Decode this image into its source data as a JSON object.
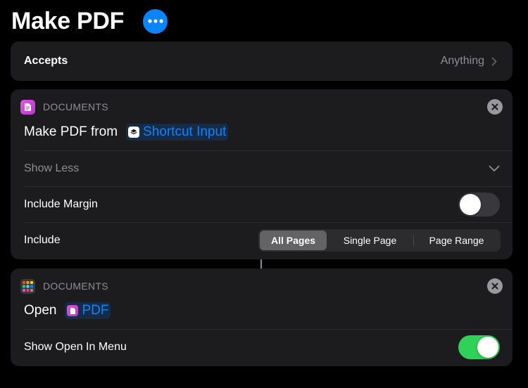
{
  "header": {
    "title": "Make PDF",
    "more_icon": "ellipsis-icon",
    "accent": "#0a84ff"
  },
  "accepts": {
    "label": "Accepts",
    "value": "Anything"
  },
  "actions": [
    {
      "category": "DOCUMENTS",
      "app_icon": "document-icon",
      "verb": "Make PDF from",
      "token": "Shortcut Input",
      "token_icon": "shortcuts-icon",
      "show_less": "Show Less",
      "include_margin": {
        "label": "Include Margin",
        "enabled": false
      },
      "include": {
        "label": "Include",
        "options": [
          "All Pages",
          "Single Page",
          "Page Range"
        ],
        "selected": "All Pages"
      }
    },
    {
      "category": "DOCUMENTS",
      "app_icon": "app-grid-icon",
      "verb": "Open",
      "token": "PDF",
      "token_icon": "document-icon",
      "show_open_in_menu": {
        "label": "Show Open In Menu",
        "enabled": true
      }
    }
  ],
  "colors": {
    "background": "#000000",
    "card": "#1c1c1e",
    "toggle_on": "#30d158",
    "token_text": "#0a84ff",
    "documents_icon": "#d14ae0"
  }
}
